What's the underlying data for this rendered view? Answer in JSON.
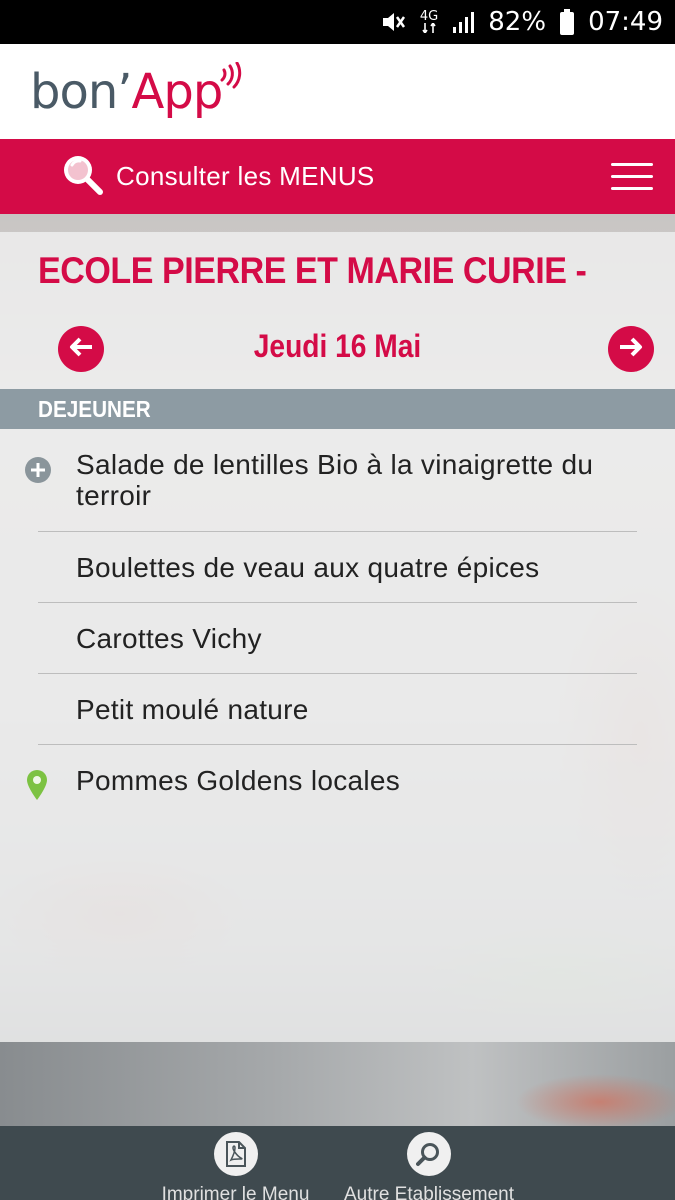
{
  "status_bar": {
    "network": "4G",
    "battery": "82%",
    "time": "07:49"
  },
  "header": {
    "logo_part1": "bon’",
    "logo_part2": "App"
  },
  "top_bar": {
    "search_label": "Consulter les MENUS"
  },
  "school": {
    "name": "ECOLE PIERRE ET MARIE CURIE -"
  },
  "day_nav": {
    "date": "Jeudi 16 Mai"
  },
  "meal": {
    "section": "DEJEUNER",
    "items": [
      {
        "label": "Salade de lentilles Bio à la vinaigrette du terroir",
        "icon": "plus-circle-icon"
      },
      {
        "label": "Boulettes de veau aux quatre épices",
        "icon": ""
      },
      {
        "label": "Carottes Vichy",
        "icon": ""
      },
      {
        "label": "Petit moulé nature",
        "icon": ""
      },
      {
        "label": "Pommes Goldens locales",
        "icon": "location-pin-icon"
      }
    ]
  },
  "toolbar": {
    "print_label": "Imprimer le Menu",
    "other_label": "Autre Etablissement"
  },
  "colors": {
    "brand_red": "#d40b47",
    "section_gray": "#8d9ba3",
    "toolbar_dark": "#3f4a4f",
    "local_green": "#7cc242"
  }
}
